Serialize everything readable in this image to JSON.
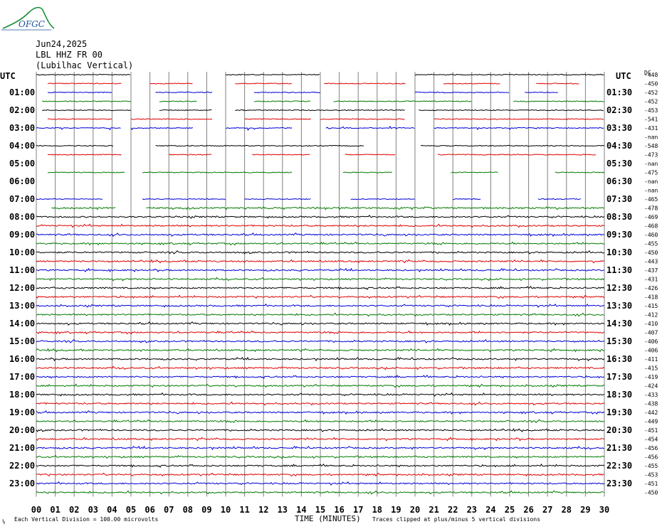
{
  "logo": {
    "text": "OFGC",
    "accent": "#1a8f3a",
    "text_color": "#1d4f9a"
  },
  "header": {
    "date": "Jun24,2025",
    "station": "LBL HHZ FR 00",
    "location": "(Lubilhac Vertical)"
  },
  "utc_label_left": "UTC",
  "utc_label_right": "UTC",
  "dc_label": "DC",
  "footer": {
    "scale": "Each Vertical Division =  100.00 microvolts",
    "xlabel": "TIME (MINUTES)",
    "clip_note": "Traces clipped at plus/minus 5 vertical divisions",
    "corner_mark": "⅛"
  },
  "colors": {
    "black": "#000000",
    "red": "#e00000",
    "blue": "#0000d8",
    "green": "#007a00",
    "grid": "#808080"
  },
  "chart_data": {
    "type": "line",
    "title": "",
    "xlabel": "TIME (MINUTES)",
    "xlim": [
      0,
      30
    ],
    "x_ticks": [
      "00",
      "01",
      "02",
      "03",
      "04",
      "05",
      "06",
      "07",
      "08",
      "09",
      "10",
      "11",
      "12",
      "13",
      "14",
      "15",
      "16",
      "17",
      "18",
      "19",
      "20",
      "21",
      "22",
      "23",
      "24",
      "25",
      "26",
      "27",
      "28",
      "29",
      "30"
    ],
    "left_hour_labels": [
      "01:00",
      "02:00",
      "03:00",
      "04:00",
      "05:00",
      "06:00",
      "07:00",
      "08:00",
      "09:00",
      "10:00",
      "11:00",
      "12:00",
      "13:00",
      "14:00",
      "15:00",
      "16:00",
      "17:00",
      "18:00",
      "19:00",
      "20:00",
      "21:00",
      "22:00",
      "23:00"
    ],
    "right_hour_labels": [
      "01:30",
      "02:30",
      "03:30",
      "04:30",
      "05:30",
      "06:30",
      "07:30",
      "08:30",
      "09:30",
      "10:30",
      "11:30",
      "12:30",
      "13:30",
      "14:30",
      "15:30",
      "16:30",
      "17:30",
      "18:30",
      "19:30",
      "20:30",
      "21:30",
      "22:30",
      "23:30"
    ],
    "color_cycle": [
      "black",
      "red",
      "blue",
      "green"
    ],
    "dc_offsets": [
      "-448",
      "-450",
      "-452",
      "-452",
      "-453",
      "-541",
      "-431",
      "-nan",
      "-548",
      "-473",
      "-nan",
      "-475",
      "-nan",
      "-nan",
      "-465",
      "-478",
      "-469",
      "-468",
      "-460",
      "-455",
      "-450",
      "-443",
      "-437",
      "-431",
      "-426",
      "-418",
      "-415",
      "-412",
      "-410",
      "-407",
      "-406",
      "-406",
      "-411",
      "-415",
      "-419",
      "-424",
      "-433",
      "-438",
      "-442",
      "-449",
      "-451",
      "-454",
      "-456",
      "-456",
      "-455",
      "-453",
      "-451",
      "-450"
    ],
    "segments": [
      [
        [
          0,
          5
        ],
        [
          10,
          15
        ],
        [
          20,
          30
        ]
      ],
      [
        [
          0.6,
          4.5
        ],
        [
          6,
          8.3
        ],
        [
          10.5,
          13.5
        ],
        [
          15.2,
          19.5
        ],
        [
          21.5,
          24.5
        ],
        [
          26.4,
          28.7
        ]
      ],
      [
        [
          0.6,
          4
        ],
        [
          6.3,
          9.3
        ],
        [
          11.5,
          15
        ],
        [
          20,
          25
        ],
        [
          25.8,
          27.6
        ]
      ],
      [
        [
          0.3,
          5
        ],
        [
          6.5,
          8.5
        ],
        [
          11.5,
          14.5
        ],
        [
          15.7,
          23
        ],
        [
          25.2,
          30
        ]
      ],
      [
        [
          0.3,
          5
        ],
        [
          6.5,
          9.3
        ],
        [
          10.5,
          19.5
        ],
        [
          20.2,
          30
        ]
      ],
      [
        [
          0.6,
          4
        ],
        [
          5,
          9.3
        ],
        [
          11,
          14.5
        ],
        [
          15,
          19.5
        ],
        [
          21,
          30
        ]
      ],
      [
        [
          0,
          4.5
        ],
        [
          5,
          8.3
        ],
        [
          10,
          13.5
        ],
        [
          15.3,
          20
        ],
        [
          21,
          30
        ]
      ],
      [],
      [
        [
          0,
          4.1
        ],
        [
          6.3,
          17.3
        ],
        [
          20.3,
          30
        ]
      ],
      [
        [
          0.6,
          4.5
        ],
        [
          7,
          9.3
        ],
        [
          11.4,
          14.5
        ],
        [
          16.3,
          19
        ],
        [
          21.2,
          29.6
        ]
      ],
      [],
      [
        [
          0.6,
          4.7
        ],
        [
          5.6,
          13.5
        ],
        [
          16.2,
          18.8
        ],
        [
          21.9,
          24.4
        ],
        [
          27.4,
          30
        ]
      ],
      [],
      [],
      [
        [
          0,
          3.5
        ],
        [
          5.6,
          10
        ],
        [
          11,
          14.5
        ],
        [
          16.6,
          20
        ],
        [
          22,
          23.5
        ],
        [
          26.5,
          28.8
        ]
      ],
      [
        [
          0.8,
          4.2
        ],
        [
          5.8,
          30
        ]
      ],
      [
        [
          0,
          30
        ]
      ],
      [
        [
          0,
          30
        ]
      ],
      [
        [
          0,
          30
        ]
      ],
      [
        [
          0,
          30
        ]
      ],
      [
        [
          0,
          30
        ]
      ],
      [
        [
          0,
          30
        ]
      ],
      [
        [
          0,
          30
        ]
      ],
      [
        [
          0,
          30
        ]
      ],
      [
        [
          0,
          30
        ]
      ],
      [
        [
          0,
          30
        ]
      ],
      [
        [
          0,
          30
        ]
      ],
      [
        [
          0,
          30
        ]
      ],
      [
        [
          0,
          30
        ]
      ],
      [
        [
          0,
          30
        ]
      ],
      [
        [
          0,
          30
        ]
      ],
      [
        [
          0,
          30
        ]
      ],
      [
        [
          0,
          30
        ]
      ],
      [
        [
          0,
          30
        ]
      ],
      [
        [
          0,
          30
        ]
      ],
      [
        [
          0,
          30
        ]
      ],
      [
        [
          0,
          30
        ]
      ],
      [
        [
          0,
          30
        ]
      ],
      [
        [
          0,
          30
        ]
      ],
      [
        [
          0,
          30
        ]
      ],
      [
        [
          0,
          30
        ]
      ],
      [
        [
          0,
          30
        ]
      ],
      [
        [
          0,
          30
        ]
      ],
      [
        [
          0,
          30
        ]
      ],
      [
        [
          0,
          30
        ]
      ],
      [
        [
          0,
          30
        ]
      ],
      [
        [
          0,
          30
        ]
      ],
      [
        [
          0,
          30
        ]
      ]
    ]
  }
}
